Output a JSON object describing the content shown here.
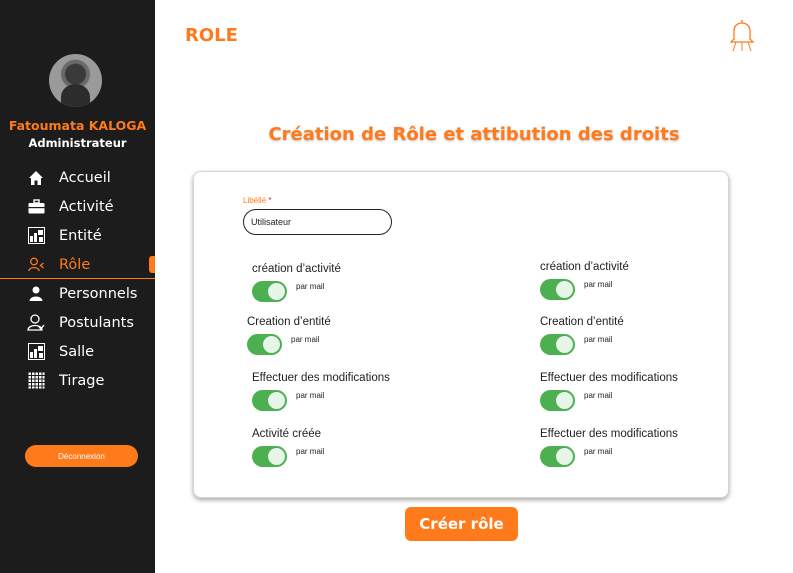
{
  "sidebar": {
    "user_name": "Fatoumata KALOGA",
    "user_role": "Administrateur",
    "items": [
      {
        "label": "Accueil",
        "icon": "home-icon"
      },
      {
        "label": "Activité",
        "icon": "briefcase-icon"
      },
      {
        "label": "Entité",
        "icon": "entity-icon"
      },
      {
        "label": "Rôle",
        "icon": "role-icon",
        "active": true
      },
      {
        "label": "Personnels",
        "icon": "person-icon"
      },
      {
        "label": "Postulants",
        "icon": "applicants-icon"
      },
      {
        "label": "Salle",
        "icon": "room-icon"
      },
      {
        "label": "Tirage",
        "icon": "grid-icon"
      }
    ],
    "logout_label": "Déconnexion"
  },
  "header": {
    "title": "ROLE",
    "bell_icon": "bell-icon"
  },
  "main": {
    "section_title": "Création de Rôle et attibution des droits",
    "form": {
      "label": "Libéllé",
      "required_mark": "*",
      "value": "Utilisateur"
    },
    "permissions_left": [
      {
        "title": "création d’activité",
        "sub": "par mail",
        "enabled": true
      },
      {
        "title": "Creation d’entité",
        "sub": "par mail",
        "enabled": true
      },
      {
        "title": "Effectuer des modifications",
        "sub": "par mail",
        "enabled": true
      },
      {
        "title": "Activité créée",
        "sub": "par mail",
        "enabled": true
      }
    ],
    "permissions_right": [
      {
        "title": "création d’activité",
        "sub": "par mail",
        "enabled": true
      },
      {
        "title": "Creation d’entité",
        "sub": "par mail",
        "enabled": true
      },
      {
        "title": "Effectuer des modifications",
        "sub": "par mail",
        "enabled": true
      },
      {
        "title": "Effectuer des modifications",
        "sub": "par mail",
        "enabled": true
      }
    ],
    "create_button": "Créer rôle"
  },
  "colors": {
    "accent": "#ff7a1a",
    "sidebar_bg": "#1c1c1c",
    "toggle_on": "#4caf50"
  }
}
